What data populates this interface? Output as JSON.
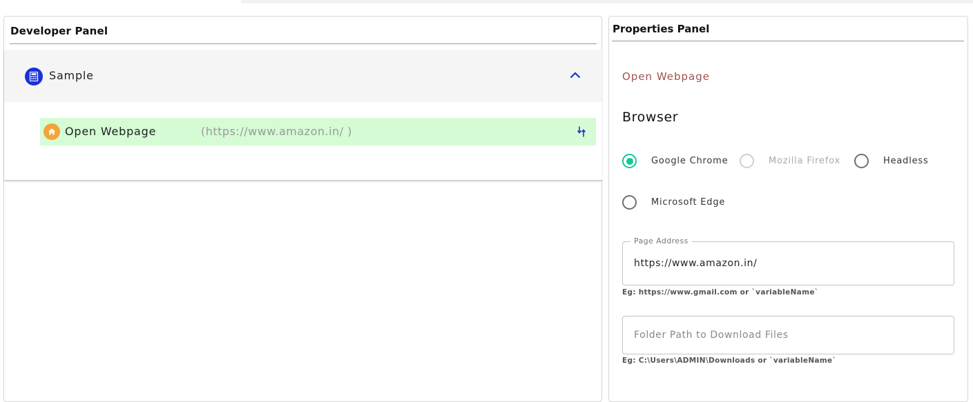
{
  "developer_panel": {
    "title": "Developer Panel",
    "group": {
      "label": "Sample",
      "icon": "calculator-icon",
      "icon_color": "#1a31d8",
      "expanded": true
    },
    "step": {
      "label": "Open Webpage",
      "url": "(https://www.amazon.in/ )",
      "icon": "home-icon",
      "icon_color": "#f5a43a",
      "highlight_color": "#d5fcd5"
    }
  },
  "properties_panel": {
    "title": "Properties Panel",
    "action_name": "Open Webpage",
    "browser_heading": "Browser",
    "browsers": [
      {
        "label": "Google Chrome",
        "checked": true,
        "disabled": false
      },
      {
        "label": "Mozilla Firefox",
        "checked": false,
        "disabled": true
      },
      {
        "label": "Headless",
        "checked": false,
        "disabled": false
      },
      {
        "label": "Microsoft Edge",
        "checked": false,
        "disabled": false
      }
    ],
    "accent_color": "#13c79a",
    "page_address": {
      "label": "Page Address",
      "value": "https://www.amazon.in/",
      "helper": "Eg: https://www.gmail.com or `variableName`"
    },
    "download_path": {
      "placeholder": "Folder Path to Download Files",
      "value": "",
      "helper": "Eg: C:\\Users\\ADMIN\\Downloads or `variableName`"
    }
  }
}
